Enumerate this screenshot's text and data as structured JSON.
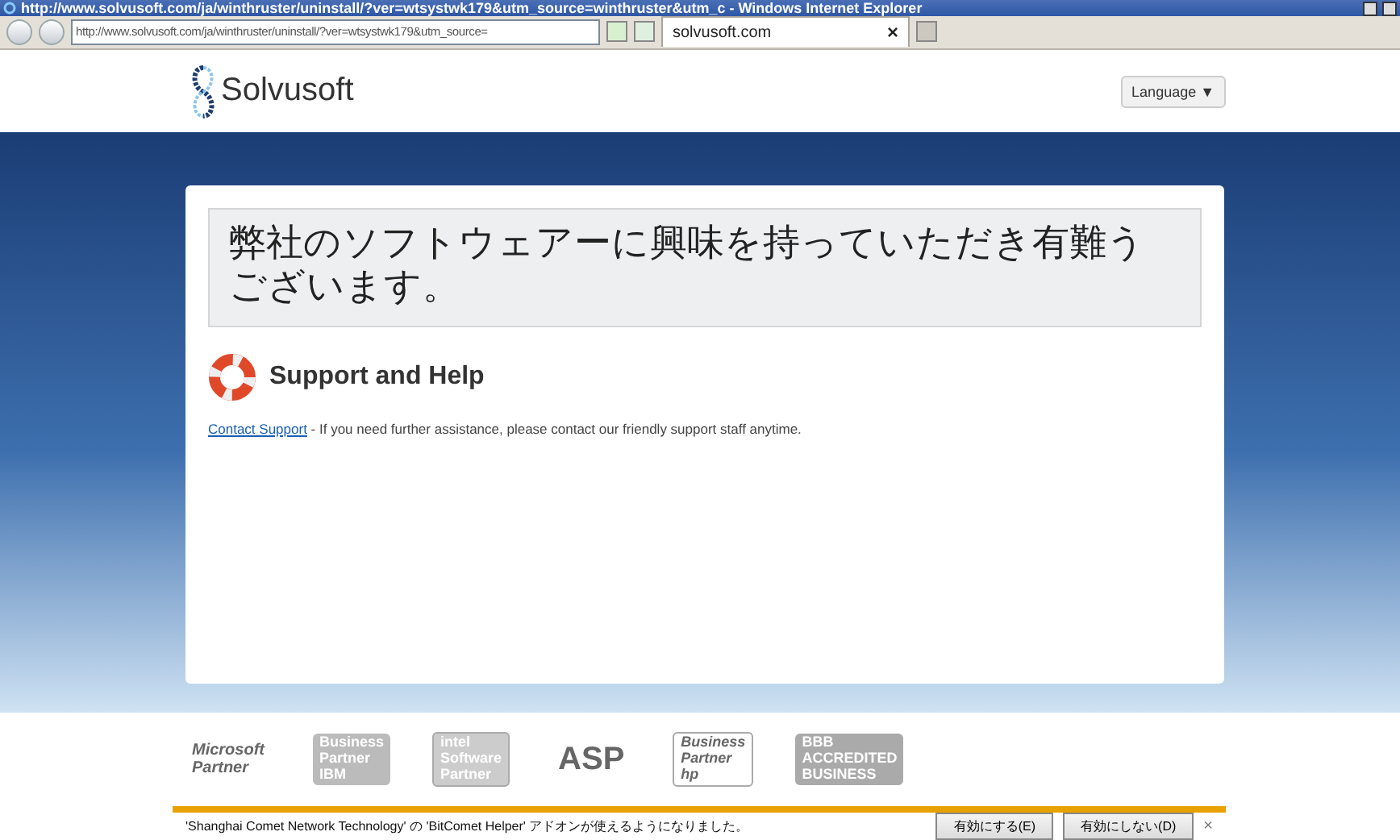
{
  "window": {
    "title": "http://www.solvusoft.com/ja/winthruster/uninstall/?ver=wtsystwk179&utm_source=winthruster&utm_c - Windows Internet Explorer"
  },
  "address_bar": {
    "value": "http://www.solvusoft.com/ja/winthruster/uninstall/?ver=wtsystwk179&utm_source="
  },
  "tabs": [
    {
      "label": "solvusoft.com",
      "selected": true,
      "close": "×"
    }
  ],
  "header": {
    "logo": "Solvusoft",
    "language_button": "Language ▼"
  },
  "card": {
    "heading": "弊社のソフトウェアーに興味を持っていただき有難うございます。",
    "section_title": "Support and Help",
    "link": "Contact Support",
    "text": " - If you need further assistance, please contact our friendly support staff anytime."
  },
  "partners": [
    {
      "kind": "microsoft",
      "lines": [
        "Microsoft",
        "Partner"
      ]
    },
    {
      "kind": "ibm",
      "lines": [
        "Business",
        "Partner",
        "IBM"
      ]
    },
    {
      "kind": "intel",
      "lines": [
        "intel",
        "Software",
        "Partner"
      ]
    },
    {
      "kind": "asp",
      "lines": [
        "ASP"
      ]
    },
    {
      "kind": "hp",
      "lines": [
        "Business",
        "Partner",
        "hp"
      ]
    },
    {
      "kind": "bbb",
      "lines": [
        "BBB",
        "ACCREDITED",
        "BUSINESS"
      ]
    }
  ],
  "notification": {
    "message": "'Shanghai Comet Network Technology' の 'BitComet Helper' アドオンが使えるようになりました。",
    "buttons": [
      "有効にする(E)",
      "有効にしない(D)"
    ],
    "close": "×"
  }
}
